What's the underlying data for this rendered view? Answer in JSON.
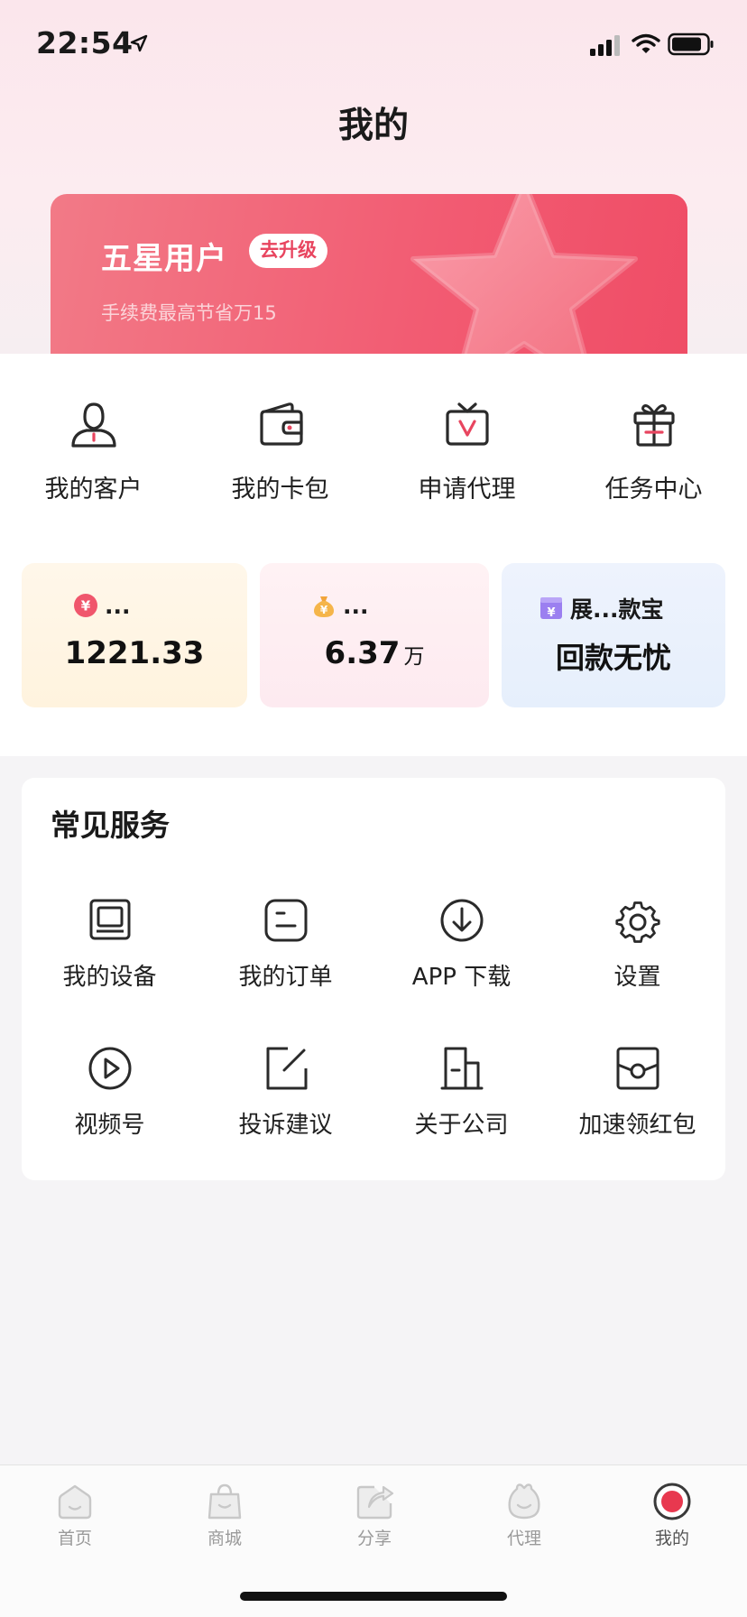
{
  "status_bar": {
    "time": "22:54"
  },
  "header": {
    "title": "我的"
  },
  "member_card": {
    "level": "五星用户",
    "upgrade_label": "去升级",
    "subtitle": "手续费最高节省万15"
  },
  "quick_actions": [
    {
      "label": "我的客户",
      "icon": "customer-icon"
    },
    {
      "label": "我的卡包",
      "icon": "wallet-icon"
    },
    {
      "label": "申请代理",
      "icon": "agent-apply-icon"
    },
    {
      "label": "任务中心",
      "icon": "gift-icon"
    }
  ],
  "feature_cards": [
    {
      "title": "...",
      "value": "1221.33",
      "unit": "",
      "icon": "yuan-coin-icon"
    },
    {
      "title": "...",
      "value": "6.37",
      "unit": "万",
      "icon": "money-bag-icon"
    },
    {
      "title": "展...款宝",
      "value": "回款无忧",
      "unit": "",
      "icon": "yuan-box-icon"
    }
  ],
  "services": {
    "title": "常见服务",
    "items": [
      {
        "label": "我的设备",
        "icon": "device-icon"
      },
      {
        "label": "我的订单",
        "icon": "order-icon"
      },
      {
        "label": "APP 下载",
        "icon": "download-icon"
      },
      {
        "label": "设置",
        "icon": "gear-icon"
      },
      {
        "label": "视频号",
        "icon": "video-play-icon"
      },
      {
        "label": "投诉建议",
        "icon": "edit-icon"
      },
      {
        "label": "关于公司",
        "icon": "building-icon"
      },
      {
        "label": "加速领红包",
        "icon": "red-packet-icon"
      }
    ]
  },
  "tab_bar": {
    "items": [
      {
        "label": "首页",
        "icon": "home-icon"
      },
      {
        "label": "商城",
        "icon": "shop-bag-icon"
      },
      {
        "label": "分享",
        "icon": "share-icon"
      },
      {
        "label": "代理",
        "icon": "agent-icon"
      },
      {
        "label": "我的",
        "icon": "profile-icon",
        "active": true
      }
    ]
  },
  "colors": {
    "accent": "#e8455f",
    "card_gradient_start": "#f27a87",
    "card_gradient_end": "#ef4d66"
  }
}
